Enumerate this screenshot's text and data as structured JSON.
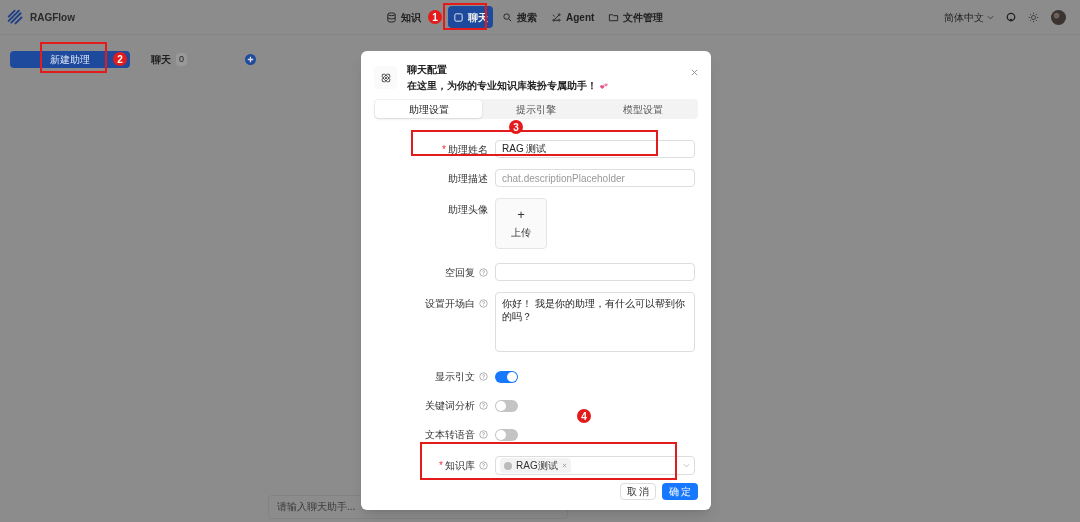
{
  "app": {
    "name": "RAGFlow"
  },
  "nav": [
    {
      "label": "知识",
      "selected": false
    },
    {
      "label": "聊天",
      "selected": true
    },
    {
      "label": "搜索",
      "selected": false
    },
    {
      "label": "Agent",
      "selected": false
    },
    {
      "label": "文件管理",
      "selected": false
    }
  ],
  "header_right": {
    "language": "简体中文"
  },
  "sidebar": {
    "new_button": "新建助理",
    "chats_title": "聊天",
    "chats_count": "0"
  },
  "chat_input": {
    "placeholder": "请输入聊天助手..."
  },
  "modal": {
    "title": "聊天配置",
    "subtitle": "在这里，为你的专业知识库装扮专属助手！",
    "tabs": [
      {
        "label": "助理设置",
        "selected": true
      },
      {
        "label": "提示引擎",
        "selected": false
      },
      {
        "label": "模型设置",
        "selected": false
      }
    ],
    "fields": [
      {
        "kind": "text",
        "label": "助理姓名",
        "required_mark": "*",
        "value": "RAG 测试"
      },
      {
        "kind": "text",
        "label": "助理描述",
        "placeholder": "chat.descriptionPlaceholder"
      },
      {
        "kind": "upload",
        "label": "助理头像",
        "plus": "+",
        "button": "上传"
      },
      {
        "kind": "text",
        "label": "空回复",
        "help": true
      },
      {
        "kind": "textarea",
        "label": "设置开场白",
        "help": true,
        "value": "你好！ 我是你的助理，有什么可以帮到你的吗？"
      },
      {
        "kind": "switch",
        "label": "显示引文",
        "help": true,
        "on": true
      },
      {
        "kind": "switch",
        "label": "关键词分析",
        "help": true,
        "on": false
      },
      {
        "kind": "switch",
        "label": "文本转语音",
        "help": true,
        "on": false
      },
      {
        "kind": "select",
        "label": "知识库",
        "required_mark": "*",
        "help": true,
        "tags": [
          "RAG测试"
        ]
      }
    ],
    "cancel": "取 消",
    "ok": "确 定"
  },
  "annotations": [
    {
      "kind": "box"
    },
    {
      "kind": "box"
    },
    {
      "kind": "box"
    },
    {
      "kind": "box"
    },
    {
      "kind": "badge",
      "label": "1"
    },
    {
      "kind": "badge",
      "label": "2"
    },
    {
      "kind": "badge",
      "label": "3"
    },
    {
      "kind": "badge",
      "label": "4"
    }
  ]
}
